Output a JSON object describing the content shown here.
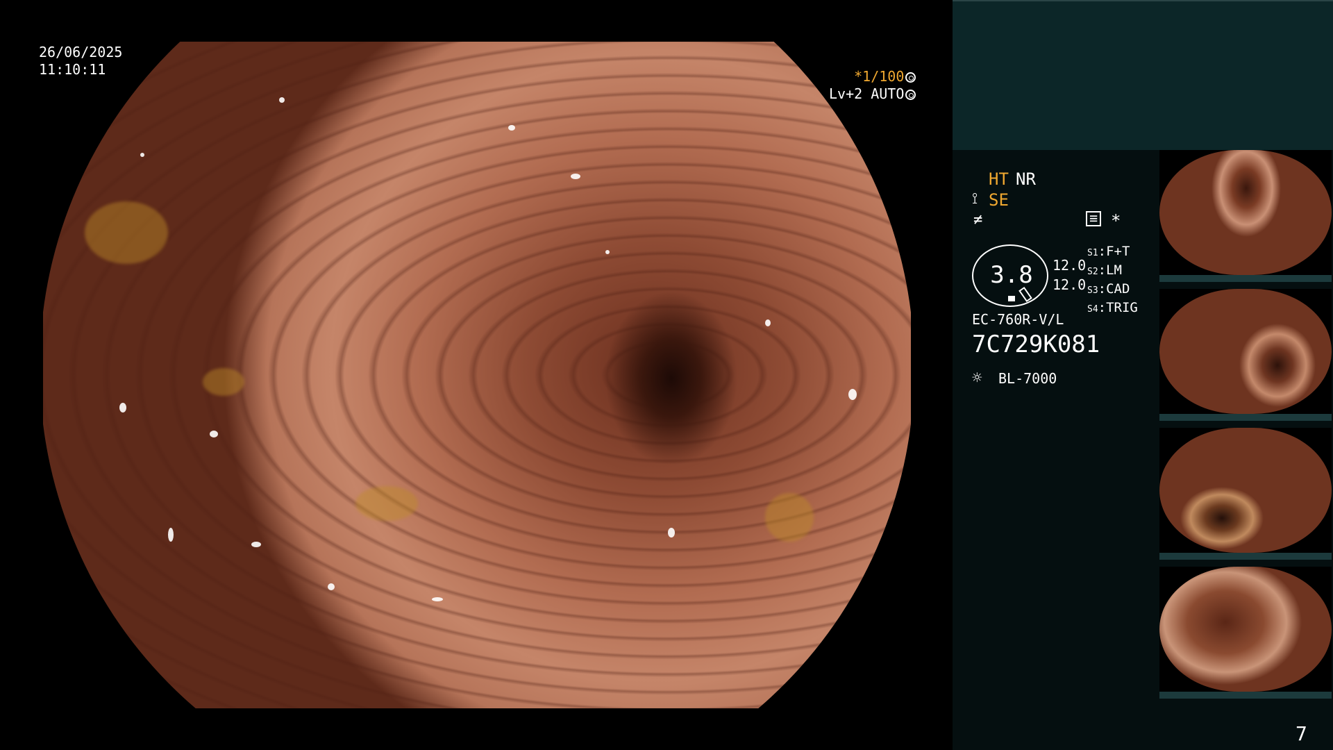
{
  "osd": {
    "date": "26/06/2025",
    "time": "11:10:11",
    "zoom_ratio": "*1/100",
    "level_mode": "Lv+2 AUTO"
  },
  "panel": {
    "ht": "HT",
    "nr": "NR",
    "se": "SE",
    "gauge_value": "3.8",
    "values": [
      "12.0",
      "12.0"
    ],
    "switches": [
      {
        "key": "S1",
        "value": "F+T"
      },
      {
        "key": "S2",
        "value": "LM"
      },
      {
        "key": "S3",
        "value": "CAD"
      },
      {
        "key": "S4",
        "value": "TRIG"
      }
    ],
    "star": "*",
    "scope_model": "EC-760R-V/L",
    "serial": "7C729K081",
    "light_source": "BL-7000"
  },
  "page_number": "7",
  "colors": {
    "accent_orange": "#f0a830",
    "panel_top": "#0c2628",
    "panel_bg": "#050f10"
  }
}
